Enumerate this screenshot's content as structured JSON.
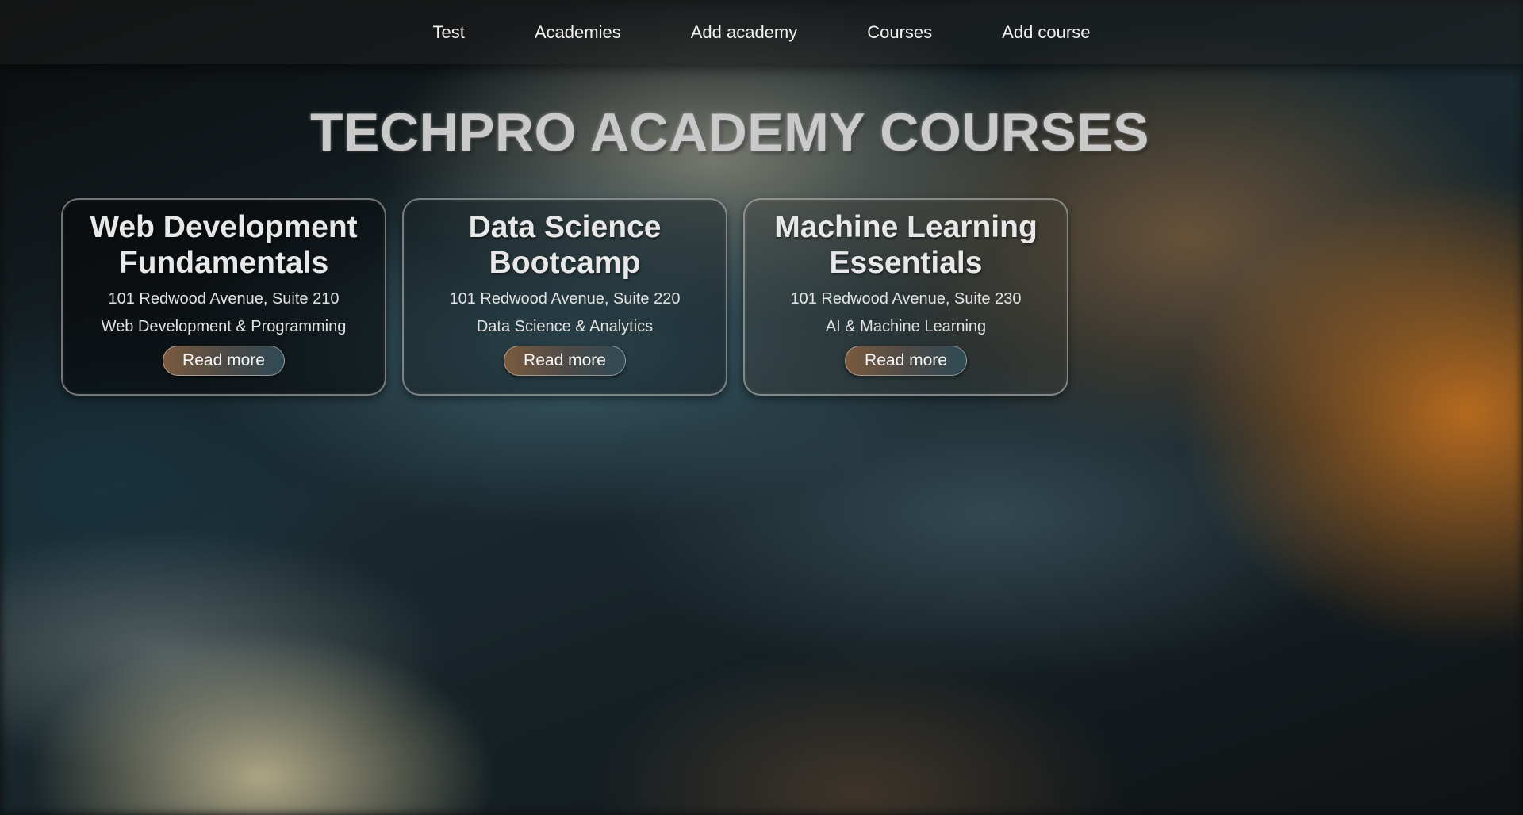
{
  "nav": {
    "items": [
      {
        "label": "Test"
      },
      {
        "label": "Academies"
      },
      {
        "label": "Add academy"
      },
      {
        "label": "Courses"
      },
      {
        "label": "Add course"
      }
    ]
  },
  "page_title": "TECHPRO ACADEMY COURSES",
  "courses": [
    {
      "title": "Web Development Fundamentals",
      "address": "101 Redwood Avenue, Suite 210",
      "category": "Web Development & Programming",
      "button_label": "Read more"
    },
    {
      "title": "Data Science Bootcamp",
      "address": "101 Redwood Avenue, Suite 220",
      "category": "Data Science & Analytics",
      "button_label": "Read more"
    },
    {
      "title": "Machine Learning Essentials",
      "address": "101 Redwood Avenue, Suite 230",
      "category": "AI & Machine Learning",
      "button_label": "Read more"
    }
  ]
}
